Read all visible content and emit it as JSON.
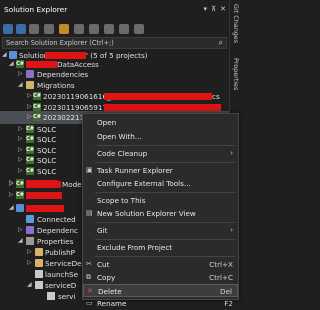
{
  "window": {
    "title": "Solution Explorer"
  },
  "search": {
    "placeholder": "Search Solution Explorer (Ctrl+;)"
  },
  "side_tabs": [
    "Git Changes",
    "Properties"
  ],
  "tree": {
    "solution_prefix": "Solution '",
    "solution_suffix": "' (5 of 5 projects)",
    "data_access_suffix": "DataAccess",
    "dependencies": "Dependencies",
    "migrations": "Migrations",
    "migration_1": "20230119061616_",
    "migration_1_suffix": "cs",
    "migration_2": "20230119065917_",
    "migration_3": "20230221100137_TemporaryMigration.cs",
    "sqlc_label": "SQLC",
    "model_suffix": "Model",
    "connected": "Connected",
    "dependenc_trunc": "Dependenc",
    "properties": "Properties",
    "publishp": "PublishP",
    "servicede": "ServiceDe",
    "launchse": "launchSe",
    "servicedep2": "serviceD",
    "service_last": "servi"
  },
  "context_menu": {
    "items": [
      {
        "label": "Open",
        "shortcut": ""
      },
      {
        "label": "Open With...",
        "shortcut": ""
      },
      {
        "label": "Code Cleanup",
        "shortcut": ""
      },
      {
        "label": "Task Runner Explorer",
        "shortcut": ""
      },
      {
        "label": "Configure External Tools...",
        "shortcut": ""
      },
      {
        "label": "Scope to This",
        "shortcut": ""
      },
      {
        "label": "New Solution Explorer View",
        "shortcut": ""
      },
      {
        "label": "Git",
        "shortcut": ""
      },
      {
        "label": "Exclude From Project",
        "shortcut": ""
      },
      {
        "label": "Cut",
        "shortcut": "Ctrl+X"
      },
      {
        "label": "Copy",
        "shortcut": "Ctrl+C"
      },
      {
        "label": "Delete",
        "shortcut": "Del"
      },
      {
        "label": "Rename",
        "shortcut": "F2"
      }
    ]
  },
  "colors": {
    "redaction": "#dc1414",
    "background": "#1f1f1f",
    "menu": "#2b2b2b"
  }
}
